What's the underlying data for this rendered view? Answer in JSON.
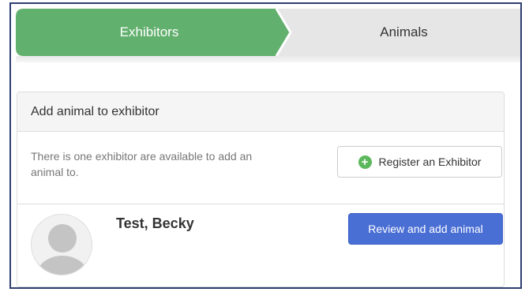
{
  "stepper": {
    "steps": [
      {
        "label": "Exhibitors",
        "active": true
      },
      {
        "label": "Animals",
        "active": false
      }
    ],
    "active_color": "#62b06e",
    "inactive_color": "#e6e6e6"
  },
  "panel": {
    "heading": "Add animal to exhibitor",
    "info_text": "There is one exhibitor are available to add an animal to.",
    "register_button": {
      "label": "Register an Exhibitor",
      "icon": "plus-circle-icon"
    },
    "exhibitor": {
      "name": "Test, Becky",
      "avatar_icon": "user-placeholder-icon",
      "action_label": "Review and add animal"
    }
  },
  "colors": {
    "primary_button": "#4a6fd4",
    "success_icon": "#5cb85c"
  }
}
